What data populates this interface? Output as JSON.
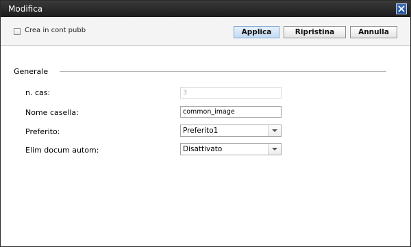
{
  "window": {
    "title": "Modifica"
  },
  "toolbar": {
    "public_checkbox_label": "Crea in cont pubb",
    "public_checkbox_checked": false,
    "apply_label": "Applica",
    "reset_label": "Ripristina",
    "cancel_label": "Annulla"
  },
  "section": {
    "title": "Generale"
  },
  "form": {
    "box_number": {
      "label": "n. cas:",
      "value": "3"
    },
    "box_name": {
      "label": "Nome casella:",
      "value": "common_image"
    },
    "favorite": {
      "label": "Preferito:",
      "value": "Preferito1"
    },
    "auto_delete": {
      "label": "Elim docum autom:",
      "value": "Disattivato"
    }
  }
}
